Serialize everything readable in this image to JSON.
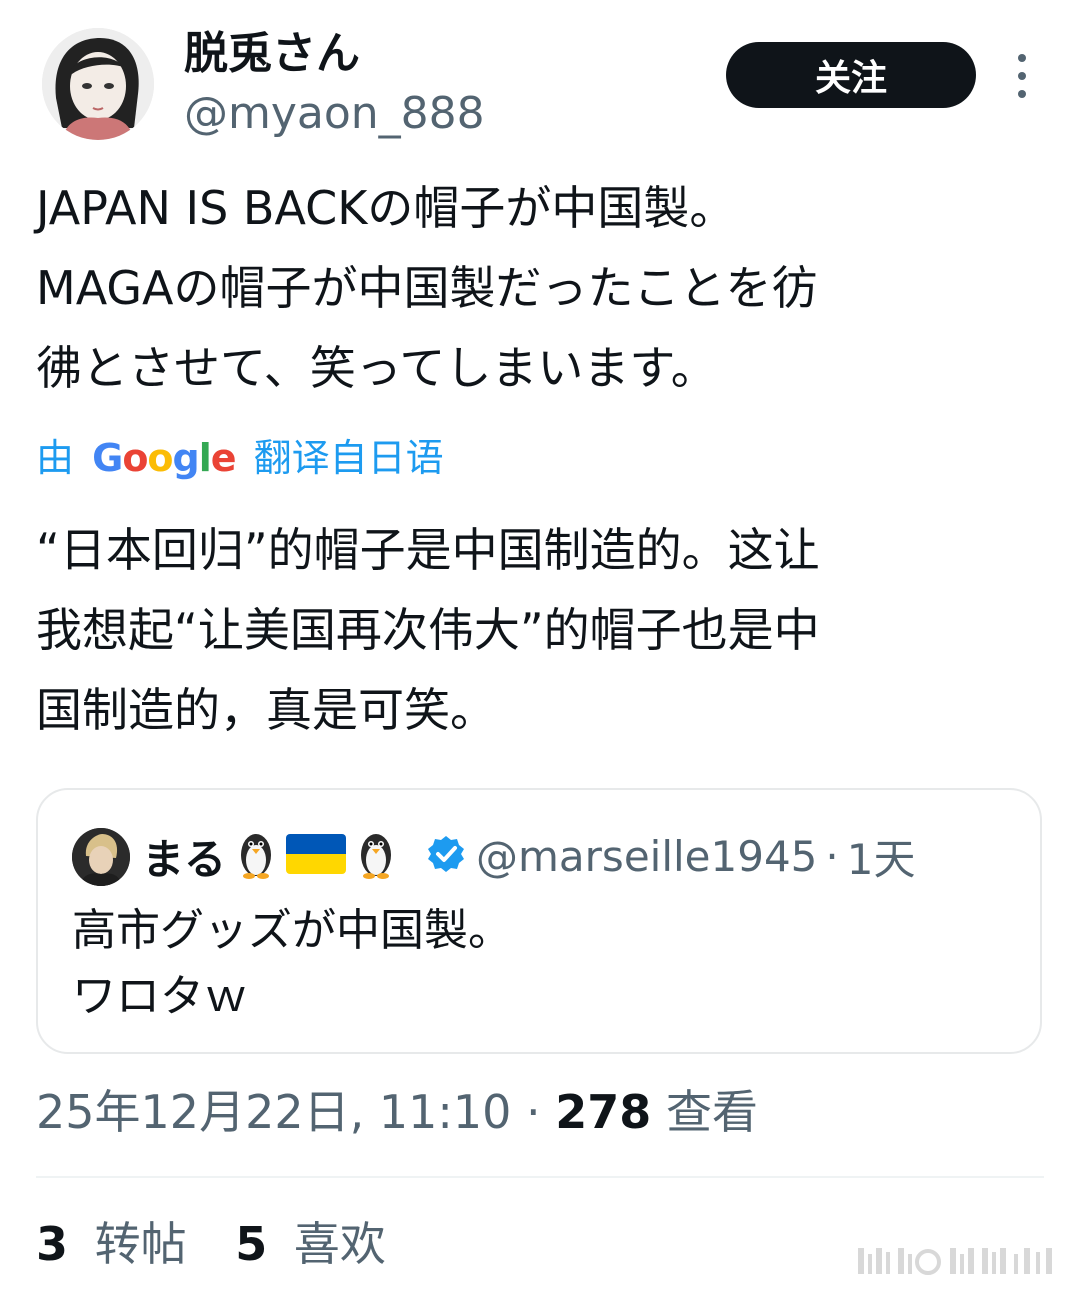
{
  "author": {
    "display_name": "脱兎さん",
    "handle": "@myaon_888"
  },
  "follow_button_label": "关注",
  "tweet": {
    "lines": [
      "JAPAN IS BACKの帽子が中国製。",
      "MAGAの帽子が中国製だったことを彷",
      "彿とさせて、笑ってしまいます。"
    ]
  },
  "translation": {
    "prefix": "由",
    "provider": "Google",
    "suffix": "翻译自日语",
    "lines": [
      "“日本回归”的帽子是中国制造的。这让",
      "我想起“让美国再次伟大”的帽子也是中",
      "国制造的，真是可笑。"
    ]
  },
  "quote": {
    "name": "まる",
    "handle": "@marseille1945",
    "separator": "·",
    "time": "1天",
    "lines": [
      "高市グッズが中国製。",
      "ワロタｗ"
    ],
    "icons": [
      "penguin-icon",
      "ukraine-flag-icon",
      "penguin-icon",
      "verified-badge-icon"
    ]
  },
  "meta": {
    "date_time": "25年12月22日, 11:10",
    "separator": "·",
    "views_count": "278",
    "views_label": "查看"
  },
  "stats": {
    "reposts_count": "3",
    "reposts_label": "转帖",
    "likes_count": "5",
    "likes_label": "喜欢"
  },
  "colors": {
    "text": "#0f1419",
    "secondary": "#536471",
    "accent": "#1d9bf0",
    "button_bg": "#0f1419",
    "border": "#e7e9ea"
  }
}
